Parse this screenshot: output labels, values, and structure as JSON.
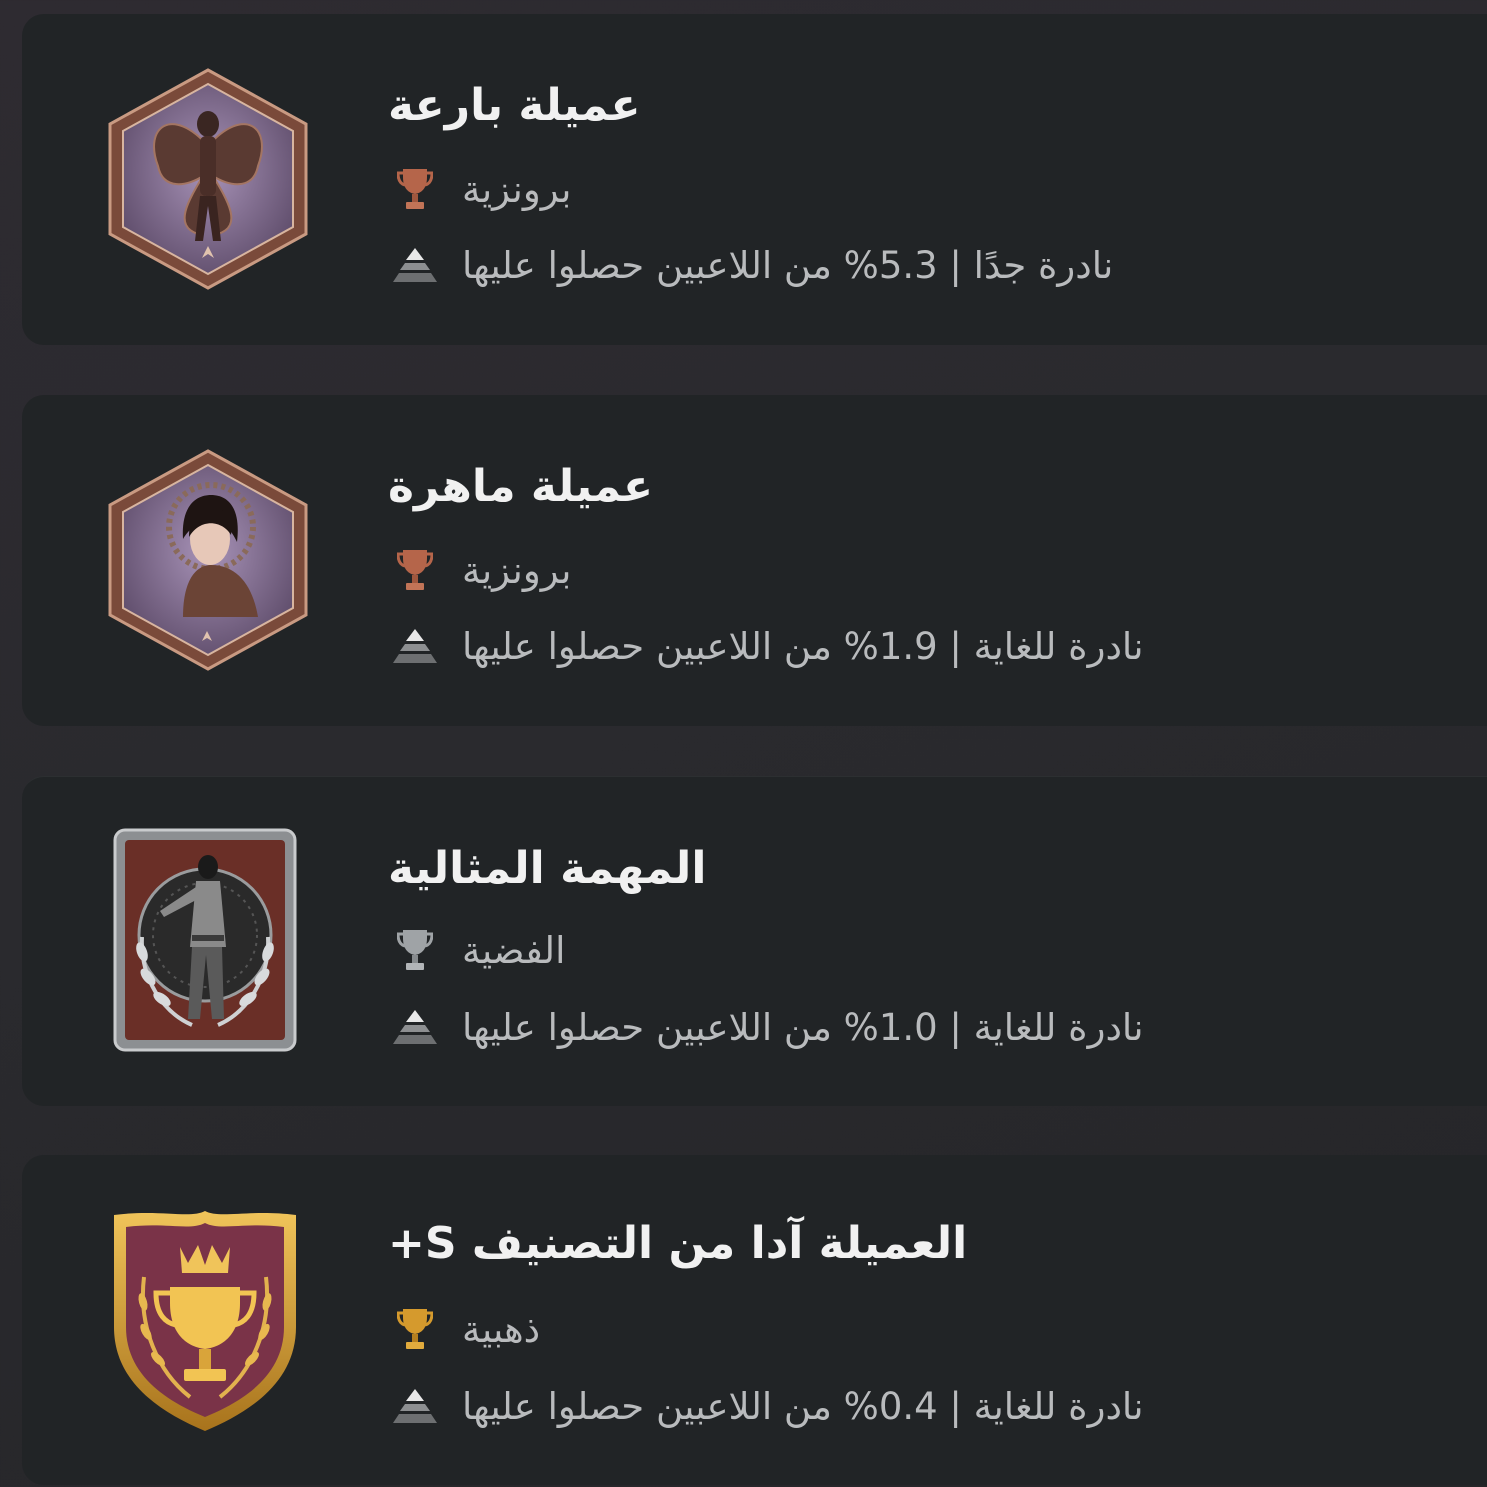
{
  "colors": {
    "background": "#2a2a2e",
    "card": "#212426",
    "title": "#f1f1f1",
    "subtext": "#b9bbbd",
    "bronze": "#b5654a",
    "silver": "#9fa3a6",
    "gold": "#d59a2d"
  },
  "trophies": [
    {
      "title": "عميلة بارعة",
      "grade_label": "برونزية",
      "grade": "bronze",
      "rarity_text": "نادرة جدًا | 5.3% من اللاعبين حصلوا عليها",
      "badge_icon": "ada-butterfly-badge-icon"
    },
    {
      "title": "عميلة ماهرة",
      "grade_label": "برونزية",
      "grade": "bronze",
      "rarity_text": "نادرة للغاية | 1.9% من اللاعبين حصلوا عليها",
      "badge_icon": "ada-portrait-badge-icon"
    },
    {
      "title": "المهمة المثالية",
      "grade_label": "الفضية",
      "grade": "silver",
      "rarity_text": "نادرة للغاية | 1.0% من اللاعبين حصلوا عليها",
      "badge_icon": "ada-laurel-badge-icon"
    },
    {
      "title": "العميلة آدا من التصنيف S+",
      "grade_label": "ذهبية",
      "grade": "gold",
      "rarity_text": "نادرة للغاية | 0.4% من اللاعبين حصلوا عليها",
      "badge_icon": "gold-cup-shield-badge-icon"
    }
  ]
}
